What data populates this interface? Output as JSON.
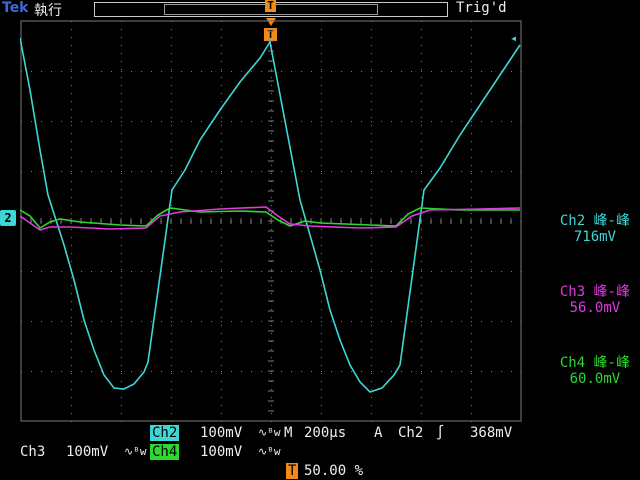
{
  "top": {
    "brand": "Tek",
    "mode": "執行",
    "trigger_status": "Trig'd",
    "trigger_marker": "T"
  },
  "channel_marker": "2",
  "trigger_level_marker": "◂",
  "measurements": [
    {
      "label": "Ch2 峰-峰",
      "value": "716mV",
      "color": "#3fd6d6"
    },
    {
      "label": "Ch3 峰-峰",
      "value": "56.0mV",
      "color": "#e03ae0"
    },
    {
      "label": "Ch4 峰-峰",
      "value": "60.0mV",
      "color": "#2fd82f"
    }
  ],
  "bottom": {
    "ch2_label": "Ch2",
    "ch2_scale": "100mV",
    "ch2_bw": "∿ᴮw",
    "timebase_label": "M",
    "timebase": "200µs",
    "trig_source_label": "A",
    "trig_source": "Ch2",
    "trig_slope": "∫",
    "trig_level": "368mV",
    "ch3_label": "Ch3",
    "ch3_scale": "100mV",
    "ch3_bw": "∿ᴮw",
    "ch4_label": "Ch4",
    "ch4_scale": "100mV",
    "ch4_bw": "∿ᴮw",
    "trig_pos_marker": "T",
    "trig_position": "50.00 %"
  },
  "colors": {
    "ch2": "#3fd6d6",
    "ch3": "#e03ae0",
    "ch4": "#2fd82f",
    "grid": "#7a7a7a",
    "trigger": "#f08a1a"
  }
}
